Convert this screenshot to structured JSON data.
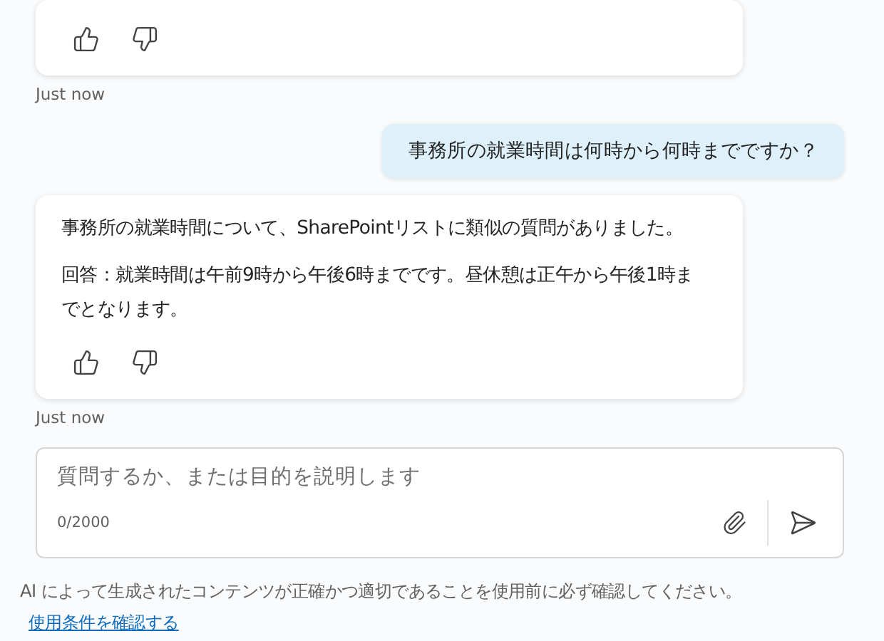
{
  "messages": [
    {
      "kind": "bot",
      "timestamp": "Just now"
    },
    {
      "kind": "user",
      "text": "事務所の就業時間は何時から何時までですか？"
    },
    {
      "kind": "bot",
      "paragraphs": [
        "事務所の就業時間について、SharePointリストに類似の質問がありました。",
        "回答：就業時間は午前9時から午後6時までです。昼休憩は正午から午後1時までとなります。"
      ],
      "timestamp": "Just now"
    }
  ],
  "composer": {
    "placeholder": "質問するか、または目的を説明します",
    "counter": "0/2000"
  },
  "disclaimer": {
    "text": "AI によって生成されたコンテンツが正確かつ適切であることを使用前に必ず確認してください。",
    "link": "使用条件を確認する"
  }
}
